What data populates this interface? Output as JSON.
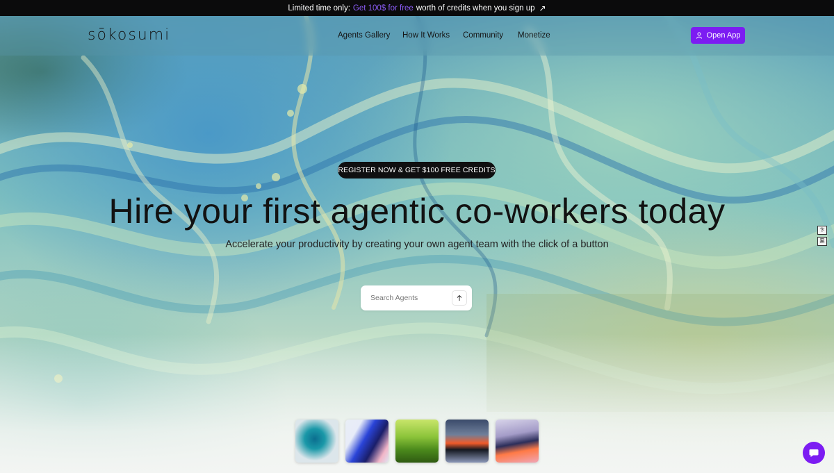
{
  "announcement": {
    "prefix": "Limited time only:",
    "highlight": "Get 100$ for free",
    "suffix": "worth of credits when you sign up",
    "arrow": "↗"
  },
  "nav": {
    "logo": "sōkosumi",
    "links": [
      "Agents Gallery",
      "How It Works",
      "Community",
      "Monetize"
    ],
    "open_app": "Open App"
  },
  "hero": {
    "badge": "REGISTER NOW & GET $100 FREE CREDITS",
    "headline": "Hire your first agentic co-workers today",
    "subheadline": "Accelerate your productivity by creating your own agent team with the click of a button",
    "search": {
      "placeholder": "Search Agents",
      "value": ""
    }
  },
  "side_widget": {
    "top": "卞",
    "bottom": "案"
  },
  "colors": {
    "accent": "#7c1cf2",
    "highlight": "#8b5cf6",
    "dark": "#0f0f10"
  }
}
